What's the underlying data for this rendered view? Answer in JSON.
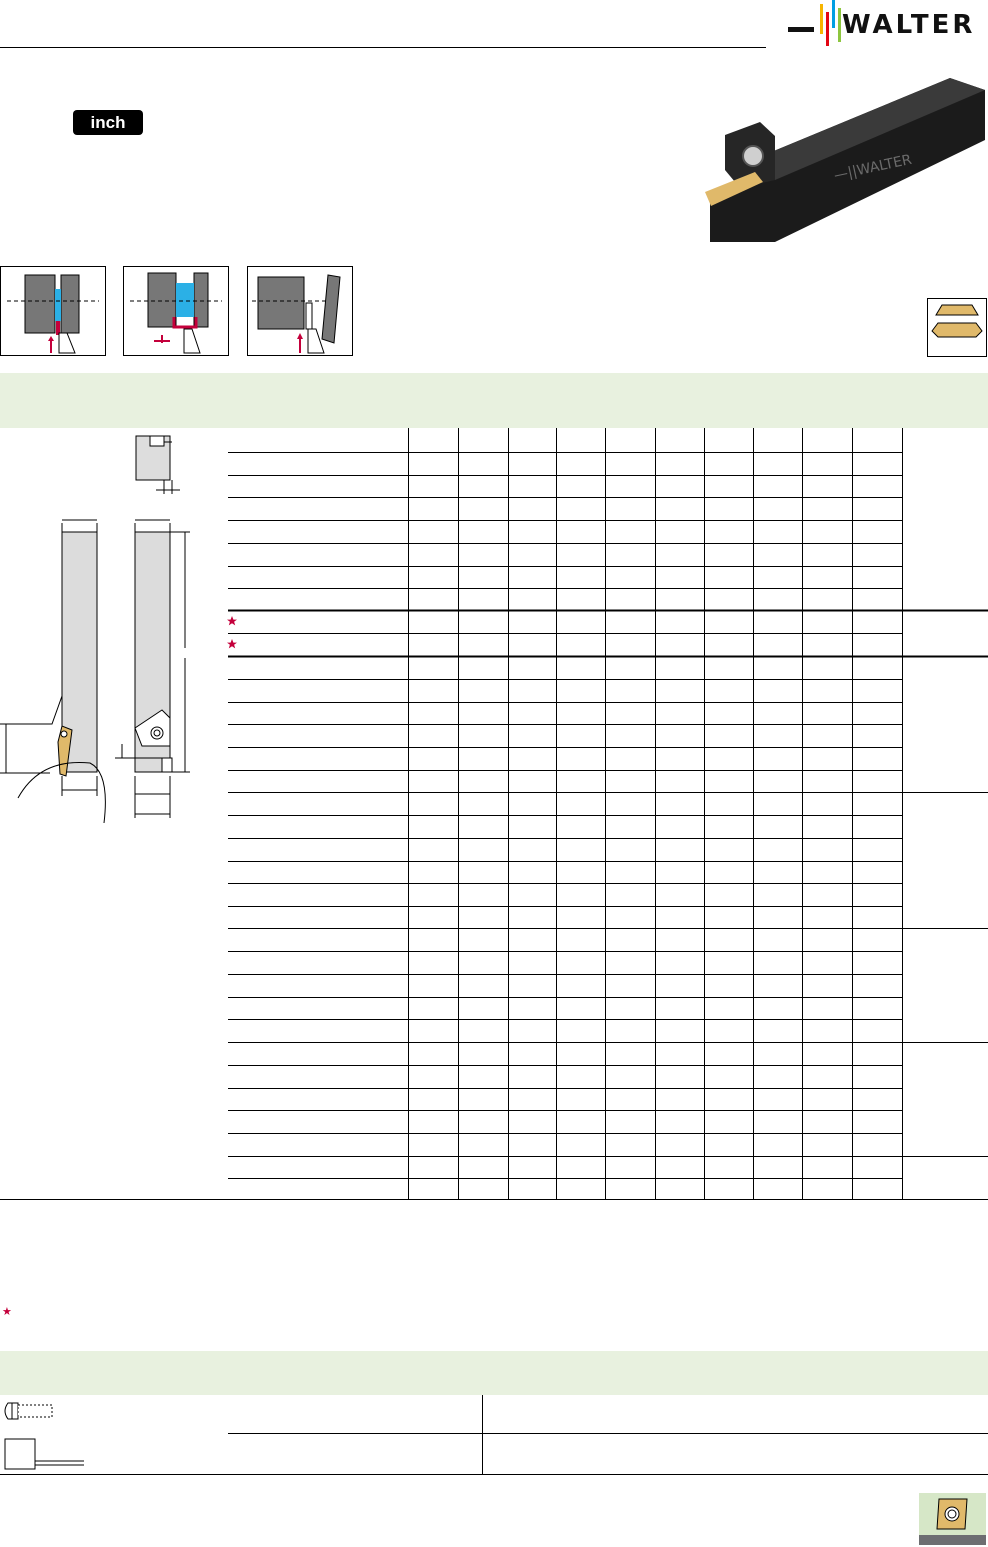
{
  "header": {
    "brand": "WALTER",
    "unit_label": "inch",
    "logo_colors": [
      "#f7b500",
      "#e30613",
      "#009fe3",
      "#8dc63f"
    ]
  },
  "icons": {
    "logo": "walter-logo-icon",
    "tool_photo": "grooving-toolholder-icon",
    "pictograms": [
      "radial-grooving-icon",
      "axial-grooving-icon",
      "parting-off-icon"
    ],
    "insert_shape": "double-ended-grooving-insert-icon",
    "screw": "clamping-screw-icon",
    "wrench": "torx-wrench-icon",
    "insert_badge": "indexable-insert-icon"
  },
  "marks": {
    "star_rows": 2,
    "footnote_star": "★"
  },
  "colors": {
    "band": "#e8f1df",
    "star": "#c4003b",
    "insert_gold": "#e0b96a",
    "groove_blue": "#2bb0e6"
  }
}
